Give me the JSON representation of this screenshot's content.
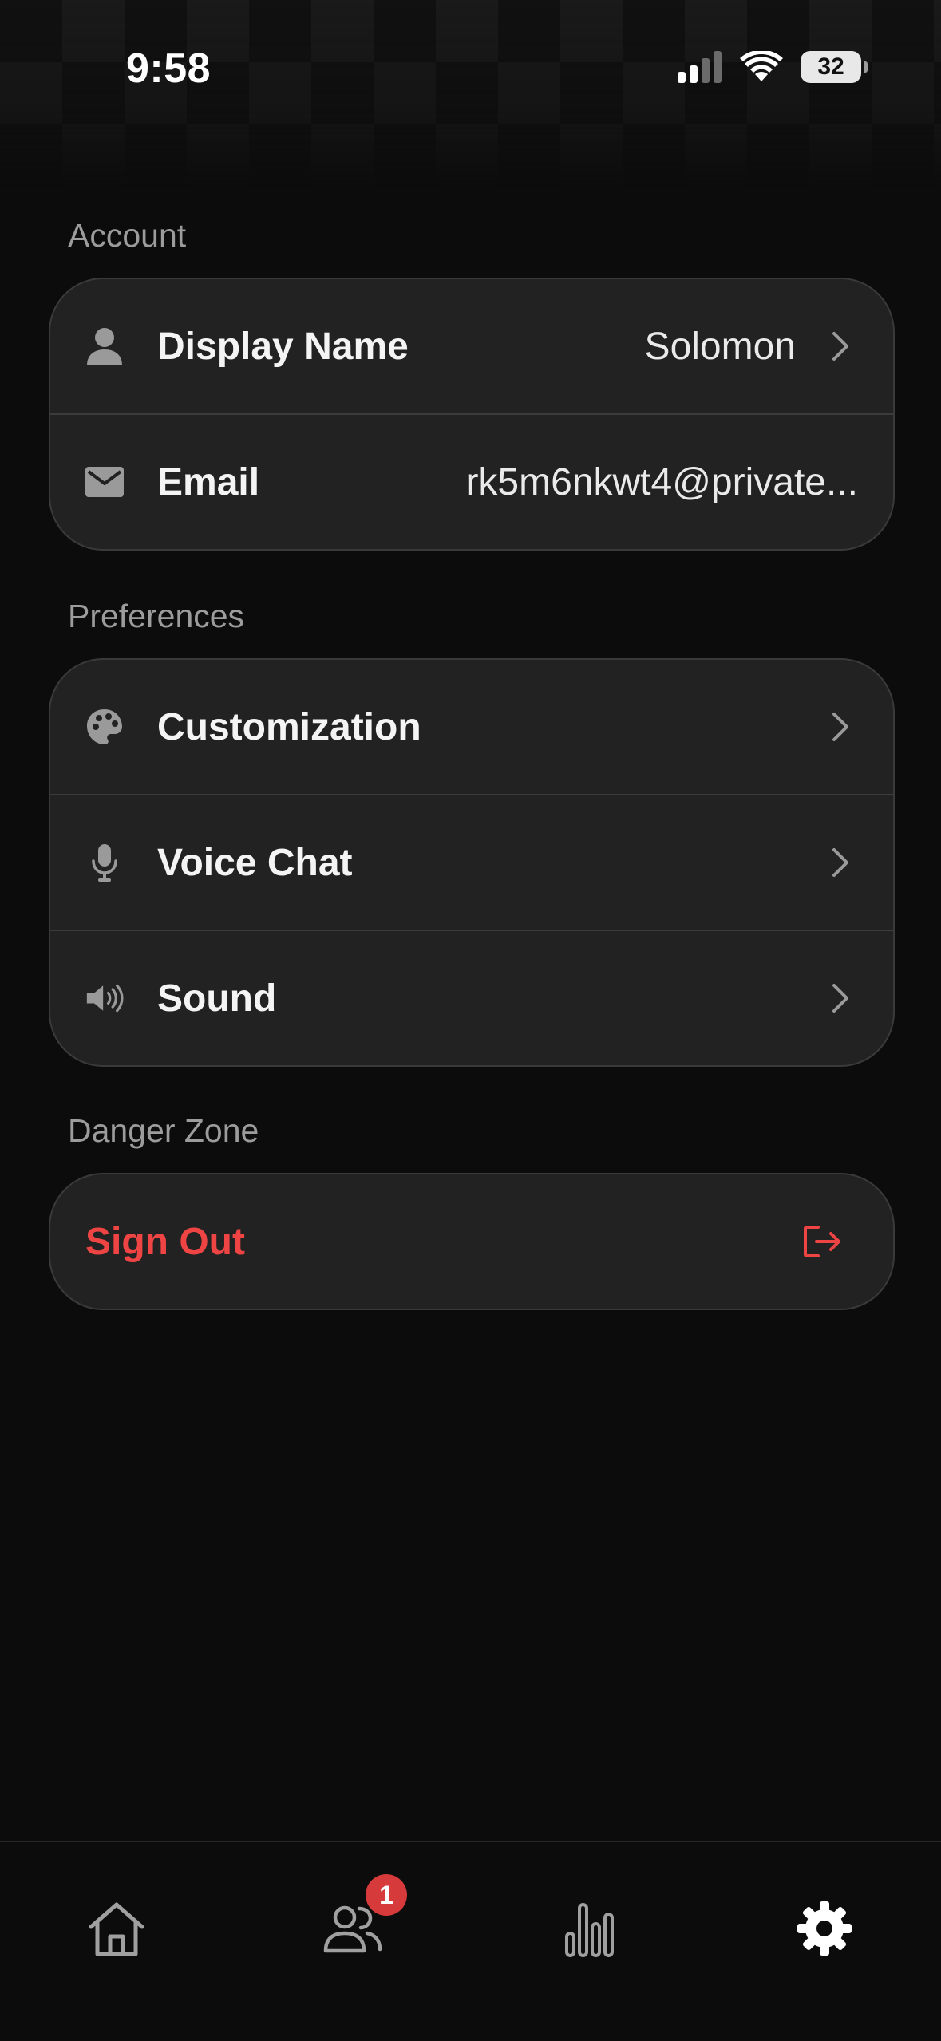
{
  "status_bar": {
    "time": "9:58",
    "battery": "32",
    "icons": [
      "cellular-signal-icon",
      "wifi-icon",
      "battery-icon"
    ]
  },
  "sections": {
    "account": {
      "title": "Account",
      "display_name_label": "Display Name",
      "display_name_value": "Solomon",
      "email_label": "Email",
      "email_value": "rk5m6nkwt4@private..."
    },
    "preferences": {
      "title": "Preferences",
      "customization_label": "Customization",
      "voice_chat_label": "Voice Chat",
      "sound_label": "Sound"
    },
    "danger_zone": {
      "title": "Danger Zone",
      "sign_out_label": "Sign Out"
    }
  },
  "tab_bar": {
    "tabs": [
      {
        "icon": "home-icon",
        "selected": false
      },
      {
        "icon": "friends-icon",
        "selected": false,
        "badge": "1"
      },
      {
        "icon": "stats-icon",
        "selected": false
      },
      {
        "icon": "settings-gear-icon",
        "selected": true
      }
    ]
  },
  "colors": {
    "background": "#0c0c0c",
    "card": "#222222",
    "danger": "#ef4444",
    "badge": "#d63a3a"
  }
}
